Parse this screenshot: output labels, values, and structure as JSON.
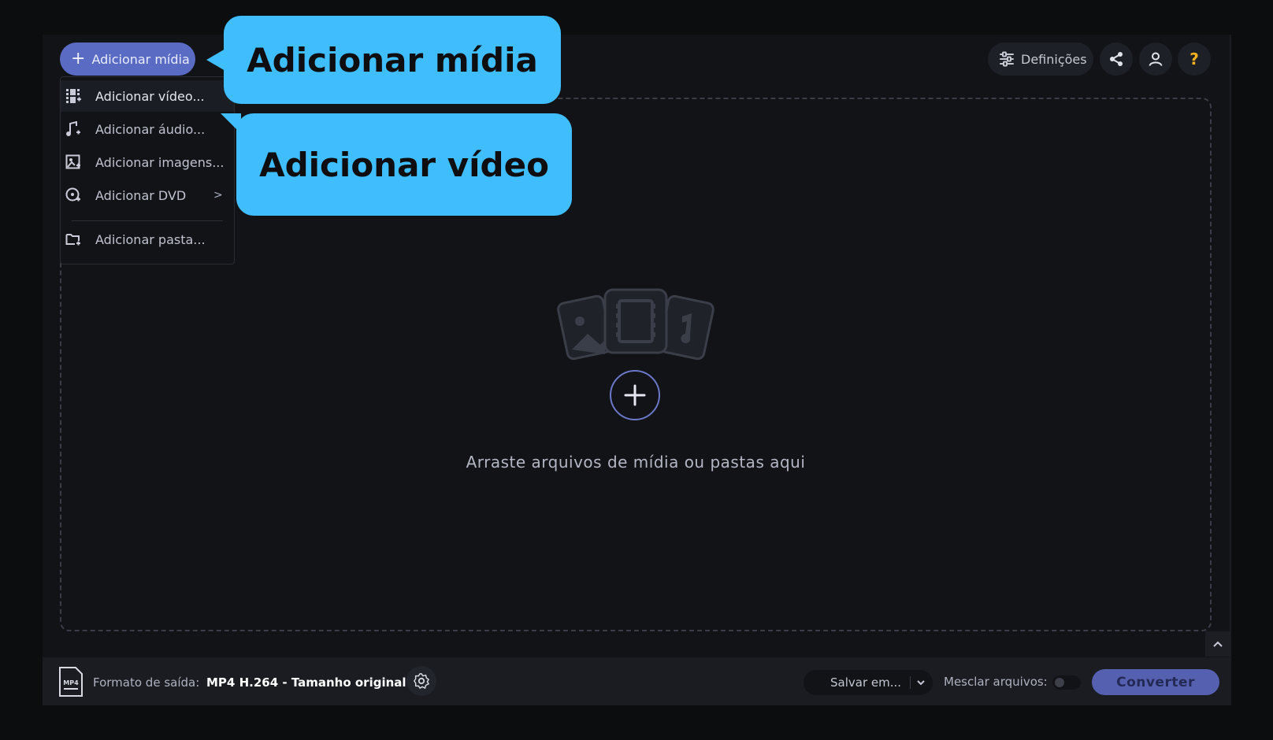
{
  "toolbar": {
    "add_media_label": "Adicionar mídia",
    "settings_label": "Definições",
    "help_label": "?"
  },
  "menu": {
    "items": [
      {
        "label": "Adicionar vídeo...",
        "icon": "video-icon"
      },
      {
        "label": "Adicionar áudio...",
        "icon": "music-note-icon"
      },
      {
        "label": "Adicionar imagens...",
        "icon": "image-icon"
      },
      {
        "label": "Adicionar DVD",
        "icon": "dvd-icon",
        "submenu_arrow": ">"
      },
      {
        "label": "Adicionar pasta...",
        "icon": "folder-add-icon"
      }
    ]
  },
  "callouts": {
    "first": "Adicionar mídia",
    "second": "Adicionar vídeo"
  },
  "dropzone": {
    "text": "Arraste arquivos de mídia ou pastas aqui"
  },
  "bottom": {
    "format_label": "Formato de saída:",
    "format_value": "MP4 H.264 - Tamanho original",
    "format_icon_text": "MP4",
    "save_label": "Salvar em...",
    "merge_label": "Mesclar arquivos:",
    "merge_enabled": false,
    "convert_label": "Converter"
  },
  "colors": {
    "accent": "#5a6bc4",
    "callout": "#40bdfd",
    "help": "#f2b21c",
    "background": "#121317"
  }
}
